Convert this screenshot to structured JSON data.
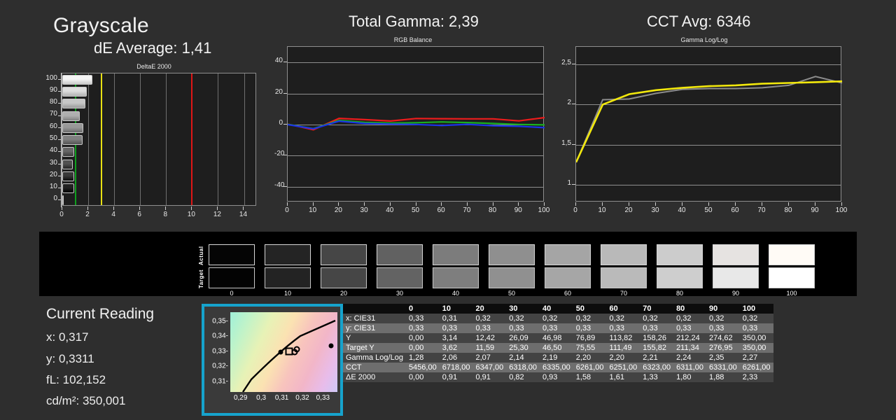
{
  "headers": {
    "grayscale": "Grayscale",
    "de_average": "dE Average: 1,41",
    "total_gamma": "Total Gamma: 2,39",
    "cct_avg": "CCT Avg: 6346"
  },
  "charts": {
    "delta_e": {
      "title": "DeltaE 2000",
      "xticks": [
        "0",
        "2",
        "4",
        "6",
        "8",
        "10",
        "12",
        "14"
      ],
      "yticks": [
        "0",
        "10",
        "20",
        "30",
        "40",
        "50",
        "60",
        "70",
        "80",
        "90",
        "100"
      ],
      "xlim": [
        0,
        15
      ],
      "warn_line": 3,
      "good_line": 1,
      "fail_line": 10,
      "colors": {
        "good": "#0fa01e",
        "warn": "#e8e113",
        "fail": "#e01616"
      }
    },
    "rgb_balance": {
      "title": "RGB Balance",
      "xticks": [
        "0",
        "10",
        "20",
        "30",
        "40",
        "50",
        "60",
        "70",
        "80",
        "90",
        "100"
      ],
      "yticks": [
        "40",
        "20",
        "0",
        "-20",
        "-40"
      ],
      "ylim": [
        -50,
        50
      ],
      "colors": {
        "red": "#ee1c1c",
        "green": "#19b021",
        "blue": "#1b32e8"
      }
    },
    "gamma_loglog": {
      "title": "Gamma Log/Log",
      "xticks": [
        "0",
        "10",
        "20",
        "30",
        "40",
        "50",
        "60",
        "70",
        "80",
        "90",
        "100"
      ],
      "yticks": [
        "2,5",
        "2",
        "1,5",
        "1"
      ],
      "ylim": [
        0.78,
        2.72
      ],
      "colors": {
        "measured": "#8c8c8c",
        "target": "#f2e80c"
      }
    },
    "cie": {
      "xticks": [
        "0,29",
        "0,3",
        "0,31",
        "0,32",
        "0,33"
      ],
      "yticks": [
        "0,35",
        "0,34",
        "0,33",
        "0,32",
        "0,31"
      ],
      "xlim": [
        0.285,
        0.337
      ],
      "ylim": [
        0.303,
        0.356
      ]
    }
  },
  "chart_data": [
    {
      "type": "bar",
      "title": "DeltaE 2000",
      "orientation": "horizontal",
      "xlabel": "",
      "ylabel": "",
      "categories": [
        "0",
        "10",
        "20",
        "30",
        "40",
        "50",
        "60",
        "70",
        "80",
        "90",
        "100"
      ],
      "values": [
        0.0,
        0.91,
        0.91,
        0.82,
        0.93,
        1.58,
        1.61,
        1.33,
        1.8,
        1.88,
        2.33
      ],
      "xlim": [
        0,
        15
      ],
      "grid": true,
      "reference_lines": [
        {
          "value": 1,
          "color": "#0fa01e"
        },
        {
          "value": 3,
          "color": "#e8e113"
        },
        {
          "value": 10,
          "color": "#e01616"
        }
      ]
    },
    {
      "type": "line",
      "title": "RGB Balance",
      "x": [
        0,
        10,
        20,
        30,
        40,
        50,
        60,
        70,
        80,
        90,
        100
      ],
      "series": [
        {
          "name": "Red",
          "values": [
            0.3,
            -3.3,
            4.0,
            3.2,
            2.3,
            3.9,
            3.8,
            3.7,
            3.7,
            2.4,
            4.5
          ]
        },
        {
          "name": "Green",
          "values": [
            0.2,
            -2.6,
            2.7,
            1.4,
            1.0,
            1.2,
            1.7,
            1.3,
            0.7,
            0.1,
            -0.2
          ]
        },
        {
          "name": "Blue",
          "values": [
            0.0,
            -2.7,
            2.2,
            0.7,
            0.3,
            0.1,
            -0.6,
            0.2,
            -0.7,
            -1.1,
            -2.0
          ]
        }
      ],
      "ylim": [
        -50,
        50
      ],
      "xlim": [
        0,
        100
      ],
      "ylabel": "",
      "xlabel": "",
      "grid": true,
      "legend": "none"
    },
    {
      "type": "line",
      "title": "Gamma Log/Log",
      "x": [
        0,
        10,
        20,
        30,
        40,
        50,
        60,
        70,
        80,
        90,
        100
      ],
      "series": [
        {
          "name": "Measured",
          "values": [
            1.28,
            2.06,
            2.07,
            2.14,
            2.19,
            2.2,
            2.2,
            2.21,
            2.24,
            2.35,
            2.27
          ]
        },
        {
          "name": "Target",
          "values": [
            1.28,
            2.0,
            2.13,
            2.18,
            2.21,
            2.23,
            2.24,
            2.26,
            2.27,
            2.28,
            2.29
          ]
        }
      ],
      "ylim": [
        0.78,
        2.72
      ],
      "xlim": [
        0,
        100
      ],
      "ylabel": "",
      "xlabel": "",
      "grid": true,
      "legend": "none"
    },
    {
      "type": "scatter",
      "title": "CIE Chromaticity",
      "xlabel": "x",
      "ylabel": "y",
      "xlim": [
        0.285,
        0.337
      ],
      "ylim": [
        0.303,
        0.356
      ],
      "points": [
        {
          "x": 0.3095,
          "y": 0.3293,
          "marker": "filled-circle"
        },
        {
          "x": 0.3135,
          "y": 0.3298,
          "marker": "open-square"
        },
        {
          "x": 0.3163,
          "y": 0.3296,
          "marker": "open-circle"
        },
        {
          "x": 0.3172,
          "y": 0.3312,
          "marker": "open-circle"
        },
        {
          "x": 0.3338,
          "y": 0.3338,
          "marker": "filled-circle"
        }
      ],
      "grid": false
    }
  ],
  "patch_strip": {
    "actual_label": "Actual",
    "target_label": "Target",
    "levels": [
      "0",
      "10",
      "20",
      "30",
      "40",
      "50",
      "60",
      "70",
      "80",
      "90",
      "100"
    ],
    "actual_colors": [
      "#050505",
      "#242424",
      "#464646",
      "#616161",
      "#7c7c7c",
      "#8f8f8f",
      "#a5a5a5",
      "#b9b9b9",
      "#cccccc",
      "#e6e3e1",
      "#fffbf6"
    ],
    "target_colors": [
      "#030303",
      "#232323",
      "#464646",
      "#636363",
      "#7e7e7e",
      "#909090",
      "#a6a6a6",
      "#bababa",
      "#cecece",
      "#e8e8e8",
      "#ffffff"
    ]
  },
  "current_reading": {
    "title": "Current Reading",
    "x": "x: 0,317",
    "y": "y: 0,3311",
    "fl": "fL: 102,152",
    "cdm2": "cd/m²: 350,001"
  },
  "table": {
    "columns": [
      "0",
      "10",
      "20",
      "30",
      "40",
      "50",
      "60",
      "70",
      "80",
      "90",
      "100"
    ],
    "rows": [
      {
        "label": "x: CIE31",
        "values": [
          "0,33",
          "0,31",
          "0,32",
          "0,32",
          "0,32",
          "0,32",
          "0,32",
          "0,32",
          "0,32",
          "0,32",
          "0,32"
        ]
      },
      {
        "label": "y: CIE31",
        "values": [
          "0,33",
          "0,33",
          "0,33",
          "0,33",
          "0,33",
          "0,33",
          "0,33",
          "0,33",
          "0,33",
          "0,33",
          "0,33"
        ]
      },
      {
        "label": "Y",
        "values": [
          "0,00",
          "3,14",
          "12,42",
          "26,09",
          "46,98",
          "76,89",
          "113,82",
          "158,26",
          "212,24",
          "274,62",
          "350,00"
        ]
      },
      {
        "label": "Target Y",
        "values": [
          "0,00",
          "3,62",
          "11,59",
          "25,30",
          "46,50",
          "75,55",
          "111,49",
          "155,82",
          "211,34",
          "276,95",
          "350,00"
        ]
      },
      {
        "label": "Gamma Log/Log",
        "values": [
          "1,28",
          "2,06",
          "2,07",
          "2,14",
          "2,19",
          "2,20",
          "2,20",
          "2,21",
          "2,24",
          "2,35",
          "2,27"
        ]
      },
      {
        "label": "CCT",
        "values": [
          "5456,00",
          "6718,00",
          "6347,00",
          "6318,00",
          "6335,00",
          "6261,00",
          "6251,00",
          "6323,00",
          "6311,00",
          "6331,00",
          "6261,00"
        ]
      },
      {
        "label": "ΔE 2000",
        "values": [
          "0,00",
          "0,91",
          "0,91",
          "0,82",
          "0,93",
          "1,58",
          "1,61",
          "1,33",
          "1,80",
          "1,88",
          "2,33"
        ]
      }
    ]
  },
  "colors": {
    "background": "#2e2e2e",
    "plot_background": "#1e1e1e",
    "accent": "#16a3cd"
  }
}
